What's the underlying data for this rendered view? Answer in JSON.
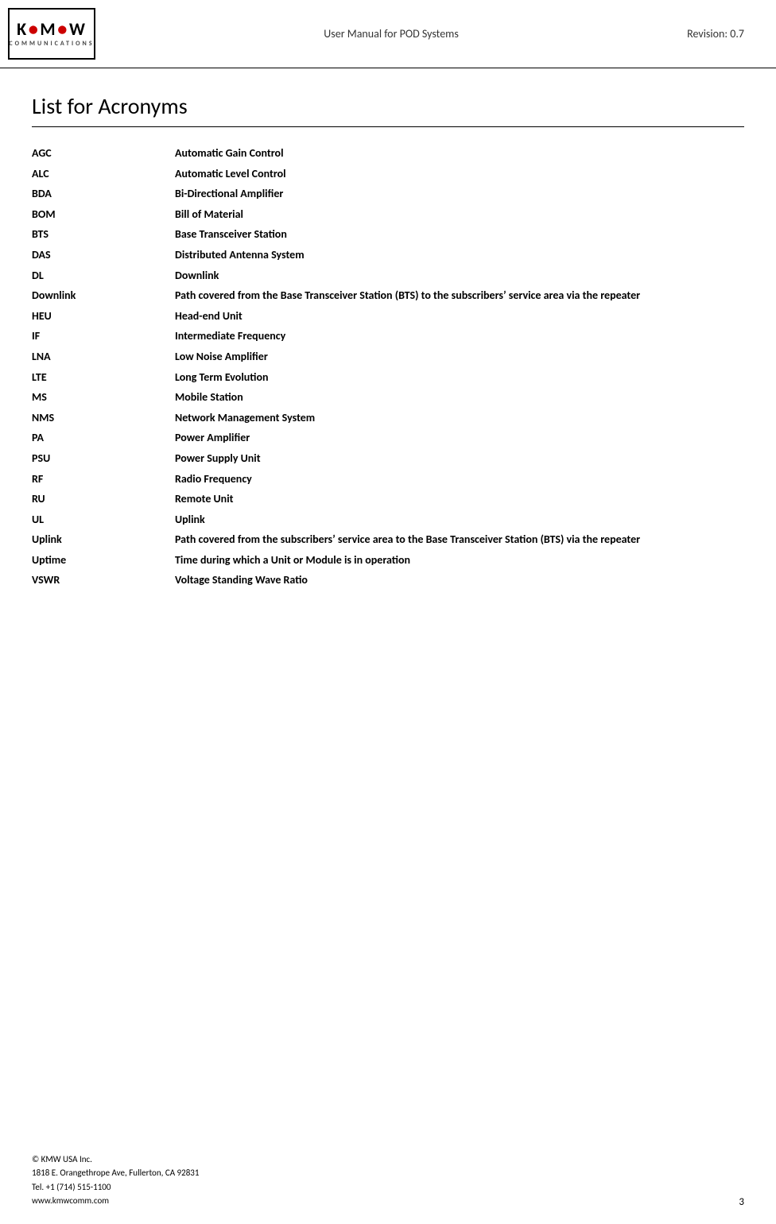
{
  "header": {
    "center_text": "User Manual for POD Systems",
    "revision": "Revision: 0.7",
    "logo_brand": "KMW",
    "logo_sub": "COMMUNICATIONS"
  },
  "page_title": "List for Acronyms",
  "acronyms": [
    {
      "abbr": "AGC",
      "definition": "Automatic Gain Control"
    },
    {
      "abbr": "ALC",
      "definition": "Automatic Level Control"
    },
    {
      "abbr": "BDA",
      "definition": "Bi-Directional Amplifier"
    },
    {
      "abbr": "BOM",
      "definition": "Bill of Material"
    },
    {
      "abbr": "BTS",
      "definition": "Base Transceiver Station"
    },
    {
      "abbr": "DAS",
      "definition": "Distributed Antenna System"
    },
    {
      "abbr": "DL",
      "definition": "Downlink"
    },
    {
      "abbr": "Downlink",
      "definition": "Path covered from the Base Transceiver Station (BTS) to the subscribers’ service area via the repeater"
    },
    {
      "abbr": "HEU",
      "definition": "Head-end Unit"
    },
    {
      "abbr": "IF",
      "definition": "Intermediate Frequency"
    },
    {
      "abbr": "LNA",
      "definition": "Low Noise Amplifier"
    },
    {
      "abbr": "LTE",
      "definition": "Long Term Evolution"
    },
    {
      "abbr": "MS",
      "definition": "Mobile Station"
    },
    {
      "abbr": "NMS",
      "definition": "Network Management System"
    },
    {
      "abbr": "PA",
      "definition": "Power Amplifier"
    },
    {
      "abbr": "PSU",
      "definition": "Power Supply Unit"
    },
    {
      "abbr": "RF",
      "definition": "Radio Frequency"
    },
    {
      "abbr": "RU",
      "definition": "Remote Unit"
    },
    {
      "abbr": "UL",
      "definition": "Uplink"
    },
    {
      "abbr": "Uplink",
      "definition": "Path covered from the subscribers’ service area to the Base Transceiver Station (BTS) via the repeater"
    },
    {
      "abbr": "Uptime",
      "definition": "Time during which a Unit or Module is in operation"
    },
    {
      "abbr": "VSWR",
      "definition": "Voltage Standing Wave Ratio"
    }
  ],
  "footer": {
    "company": "© KMW USA Inc.",
    "address": "1818 E. Orangethrope Ave, Fullerton, CA 92831",
    "tel": "Tel. +1 (714) 515-1100",
    "website": "www.kmwcomm.com",
    "page_number": "3"
  }
}
